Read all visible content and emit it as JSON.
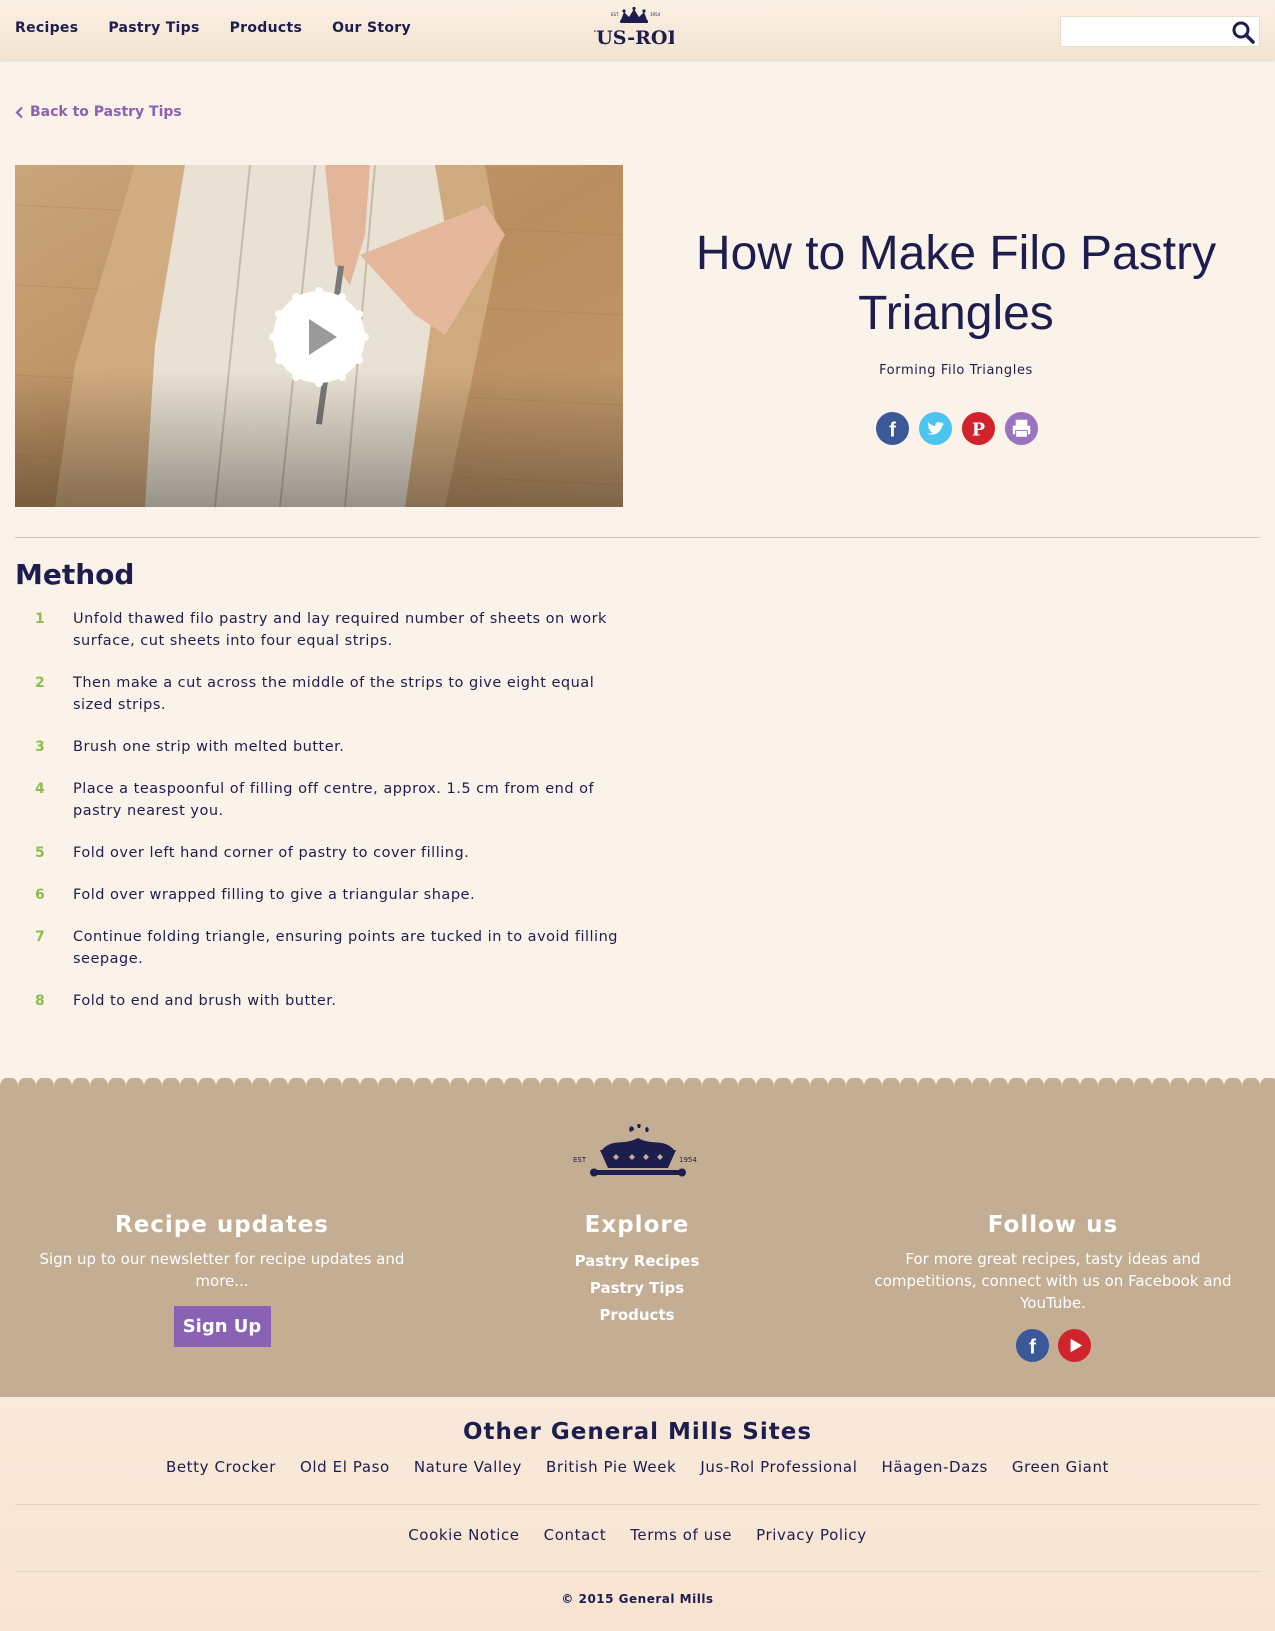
{
  "nav": {
    "items": [
      {
        "label": "Recipes"
      },
      {
        "label": "Pastry Tips"
      },
      {
        "label": "Products"
      },
      {
        "label": "Our Story"
      }
    ],
    "logo_text": "JUS-ROL",
    "logo_est": "EST",
    "logo_year": "1954",
    "search_placeholder": ""
  },
  "back_link": "Back to Pastry Tips",
  "hero": {
    "title": "How to Make Filo Pastry Triangles",
    "subtitle": "Forming Filo Triangles"
  },
  "method": {
    "title": "Method",
    "steps": [
      {
        "num": "1",
        "text": "Unfold thawed filo pastry and lay required number of sheets on work surface, cut sheets into four equal strips."
      },
      {
        "num": "2",
        "text": "Then make a cut across the middle of the strips to give eight equal sized strips."
      },
      {
        "num": "3",
        "text": "Brush one strip with melted butter."
      },
      {
        "num": "4",
        "text": "Place a teaspoonful of filling off centre, approx. 1.5 cm from end of pastry nearest you."
      },
      {
        "num": "5",
        "text": "Fold over left hand corner of pastry to cover filling."
      },
      {
        "num": "6",
        "text": "Fold over wrapped filling to give a triangular shape."
      },
      {
        "num": "7",
        "text": "Continue folding triangle, ensuring points are tucked in to avoid filling seepage."
      },
      {
        "num": "8",
        "text": "Fold to end and brush with butter."
      }
    ]
  },
  "footer": {
    "crest_est": "EST",
    "crest_year": "1954",
    "recipe_updates": {
      "title": "Recipe updates",
      "text": "Sign up to our newsletter for recipe updates and more...",
      "button": "Sign Up"
    },
    "explore": {
      "title": "Explore",
      "links": [
        "Pastry Recipes",
        "Pastry Tips",
        "Products"
      ]
    },
    "follow": {
      "title": "Follow us",
      "text": "For more great recipes, tasty ideas and competitions, connect with us on Facebook and YouTube."
    }
  },
  "other_sites": {
    "title": "Other General Mills Sites",
    "links": [
      "Betty Crocker",
      "Old El Paso",
      "Nature Valley",
      "British Pie Week",
      "Jus-Rol Professional",
      "Häagen-Dazs",
      "Green Giant"
    ]
  },
  "legal": {
    "links": [
      "Cookie Notice",
      "Contact",
      "Terms of use",
      "Privacy Policy"
    ],
    "copyright": "© 2015 General Mills"
  },
  "colors": {
    "navy": "#1d1d4e",
    "purple": "#8a62b3",
    "green": "#8dbd4d",
    "footer_tan": "#c3ad93",
    "facebook": "#3b5998",
    "twitter": "#4cc4ee",
    "pinterest": "#d0232b",
    "print": "#9a74c0",
    "youtube": "#d0232b"
  },
  "icons": [
    "search-icon",
    "chevron-left-icon",
    "play-icon",
    "facebook-icon",
    "twitter-icon",
    "pinterest-icon",
    "print-icon",
    "youtube-icon",
    "crown-pie-icon"
  ]
}
